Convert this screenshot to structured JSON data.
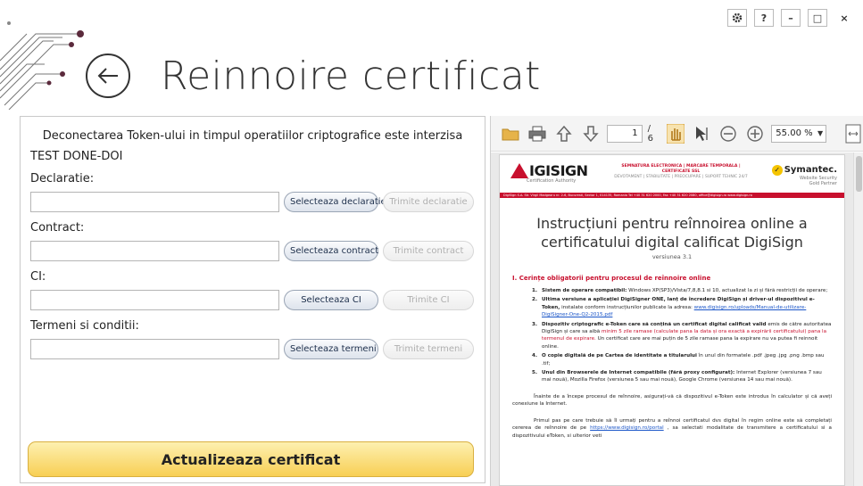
{
  "window": {
    "settings_icon": "gear-icon",
    "help_label": "?",
    "minimize_label": "–",
    "maximize_label": "□",
    "close_label": "×"
  },
  "header": {
    "title": "Reinnoire certificat",
    "back_icon": "arrow-left-icon"
  },
  "form": {
    "notice": "Deconectarea Token-ului in timpul operatiilor criptografice este interzisa",
    "token_name": "TEST DONE-DOI",
    "fields": [
      {
        "label": "Declaratie:",
        "value": "",
        "select_label": "Selecteaza declaratie",
        "send_label": "Trimite declaratie"
      },
      {
        "label": "Contract:",
        "value": "",
        "select_label": "Selecteaza contract",
        "send_label": "Trimite contract"
      },
      {
        "label": "CI:",
        "value": "",
        "select_label": "Selecteaza CI",
        "send_label": "Trimite CI"
      },
      {
        "label": "Termeni si conditii:",
        "value": "",
        "select_label": "Selecteaza termeni",
        "send_label": "Trimite termeni"
      }
    ],
    "update_button": "Actualizeaza certificat"
  },
  "viewer": {
    "current_page": "1",
    "total_pages": "/ 6",
    "zoom": "55.00 %",
    "toolbar_icons": [
      "folder-icon",
      "print-icon",
      "arrow-up-icon",
      "arrow-down-icon",
      "hand-icon",
      "select-text-icon",
      "zoom-out-icon",
      "zoom-in-icon",
      "fit-page-icon"
    ]
  },
  "document": {
    "logo_text": "IGISIGN",
    "logo_sub": "Certification Authority",
    "tagline_1": "SEMNATURA ELECTRONICA | MARCARE TEMPORALA | CERTIFICATE SSL",
    "tagline_2": "DEVOTAMENT | STABILITATE | PREOCUPARE | SUPORT TEHNIC 24/7",
    "partner_brand": "Symantec.",
    "partner_sub_1": "Website Security",
    "partner_sub_2": "Gold Partner",
    "address_bar": "DigiSign S.A.   Str. Virgil Madgearu nr. 2-6, Bucuresti, Sector 1, 014135, Romania Tel +40 31 620 2000, Fax +40 31 620 2080, office@digisign.ro   www.digisign.ro",
    "title": "Instrucțiuni pentru reînnoirea online a certificatului digital calificat DigiSign",
    "version": "versiunea 3.1",
    "section_title": "I. Cerințe obligatorii pentru procesul de reînnoire online",
    "items": [
      {
        "num": "1.",
        "bold": "Sistem de operare compatibil:",
        "text": " Windows XP(SP3)/Vista/7,8,8.1 si 10, actualizat la zi și fără restricții de operare;"
      },
      {
        "num": "2.",
        "bold": "Ultima versiune a aplicației DigiSigner ONE, lanț de încredere DigiSign și driver-ul dispozitivul e-Token,",
        "text": " instalate conform instrucțiunilor publicate la adresa: ",
        "link": "www.digisign.ro/uploads/Manual-de-utilizare-DigiSigner-One-Q2-2015.pdf"
      },
      {
        "num": "3.",
        "bold": "Dispozitiv criptografic e-Token care să conțină un certificat digital calificat valid",
        "text": " emis de către autoritatea DigiSign și care sa aibă ",
        "red": "minim 5 zile ramase (calculate pana la data și ora exactă a expirării certificatului) pana la termenul de expirare.",
        "tail": " Un certificat care are mai puțin de 5 zile ramase pana la expirare nu va putea fi reinnoit online."
      },
      {
        "num": "4.",
        "bold": "O copie digitală de pe Cartea de identitate a titularului",
        "text": " în unul din formatele .pdf .jpeg .jpg .png .bmp sau .tif;"
      },
      {
        "num": "5.",
        "bold": "Unul din Browserele de Internet compatibile (fără proxy configurat):",
        "text": " Internet Explorer (versiunea 7 sau mai nouă), Mozilla Firefox (versiunea 5 sau mai nouă), Google Chrome (versiunea 14 sau mai nouă)."
      }
    ],
    "para_1": "Înainte de a începe procesul de reînnoire, asigurați-vă că dispozitivul e-Token este introdus în calculator și că aveți conexiune la Internet.",
    "para_2_a": "Primul pas pe care trebuie să îl urmați pentru a reînnoi certificatul dvs digital în regim online este să completați cererea de reînnoire de pe ",
    "para_2_link": "https://www.digisign.ro/portal",
    "para_2_b": " , sa selectati modalitate de transmitere a certificatului si a dispozitivului eToken, si ulterior veti"
  }
}
